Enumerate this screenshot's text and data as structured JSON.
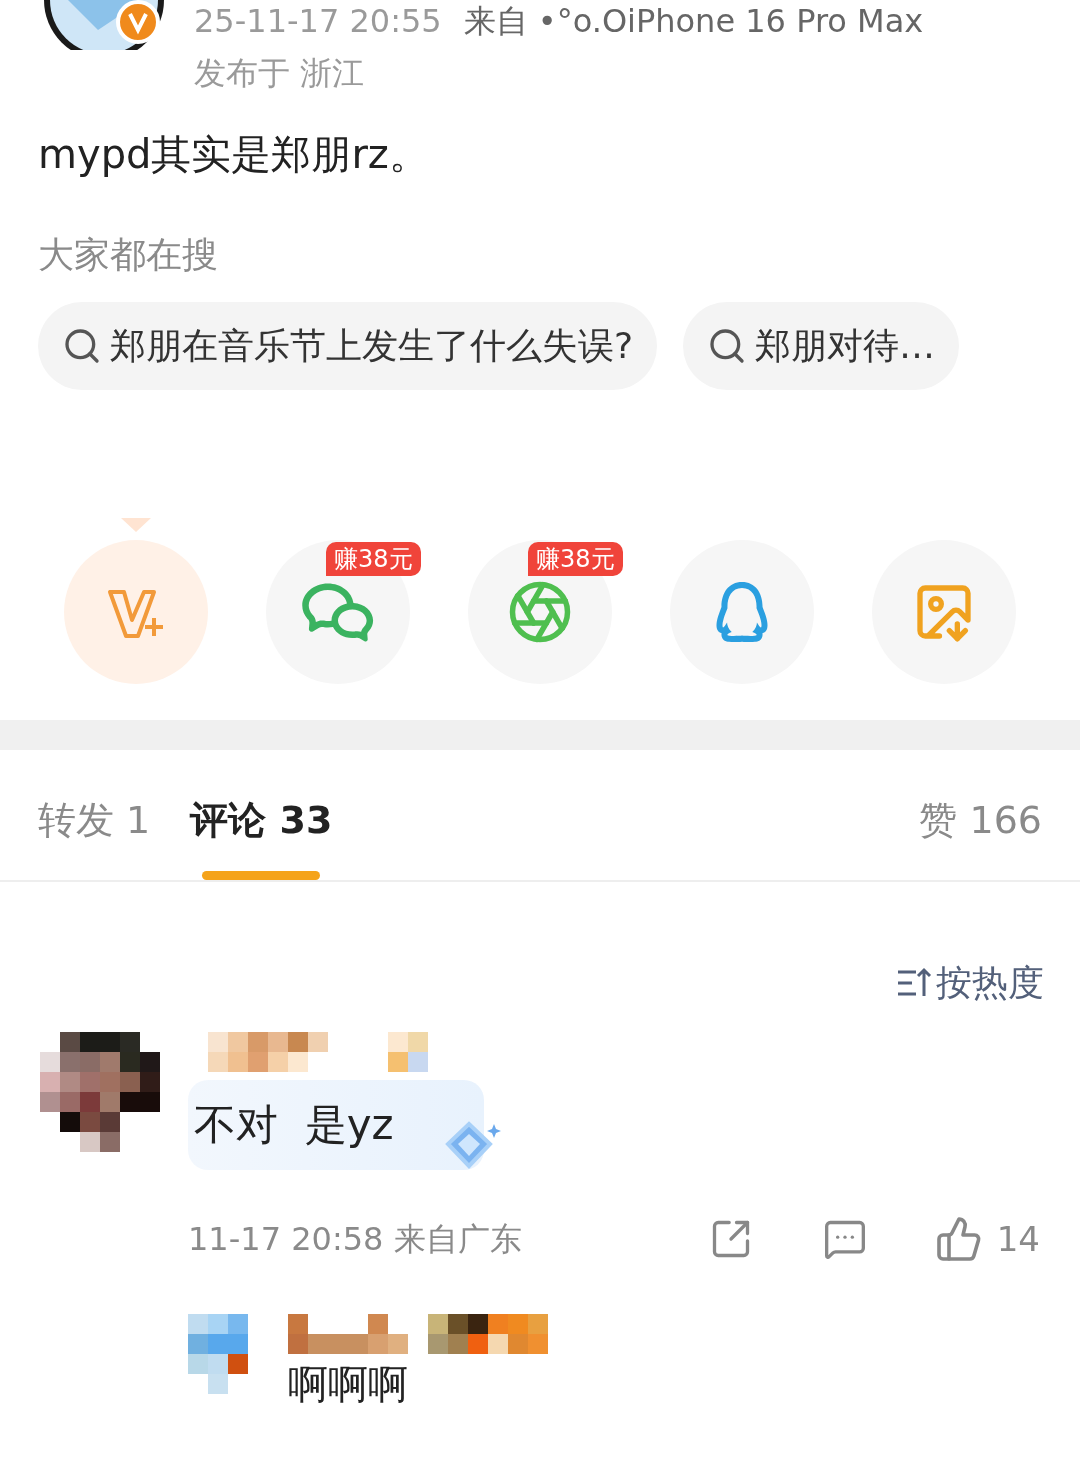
{
  "post": {
    "time": "25-11-17 20:55",
    "source": "来自 •°o.OiPhone 16 Pro Max",
    "location": "发布于 浙江",
    "text": "mypd其实是郑朋rz。"
  },
  "hot_search": {
    "title": "大家都在搜",
    "items": [
      "郑朋在音乐节上发生了什么失误?",
      "郑朋对待…"
    ]
  },
  "share_targets": [
    {
      "kind": "vplus",
      "selected": true
    },
    {
      "kind": "wechat",
      "selected": false,
      "badge": "赚38元"
    },
    {
      "kind": "moments",
      "selected": false,
      "badge": "赚38元"
    },
    {
      "kind": "qq",
      "selected": false
    },
    {
      "kind": "save_image",
      "selected": false
    }
  ],
  "tabs": [
    {
      "label": "转发 1",
      "selected": false
    },
    {
      "label": "评论 33",
      "selected": true
    }
  ],
  "likes_tab": "赞 166",
  "sort": "按热度",
  "comments": [
    {
      "text": "不对  是yz",
      "time": "11-17 20:58 来自广东",
      "likes": "14",
      "replies": [
        {
          "text": "啊啊啊"
        }
      ]
    }
  ]
}
